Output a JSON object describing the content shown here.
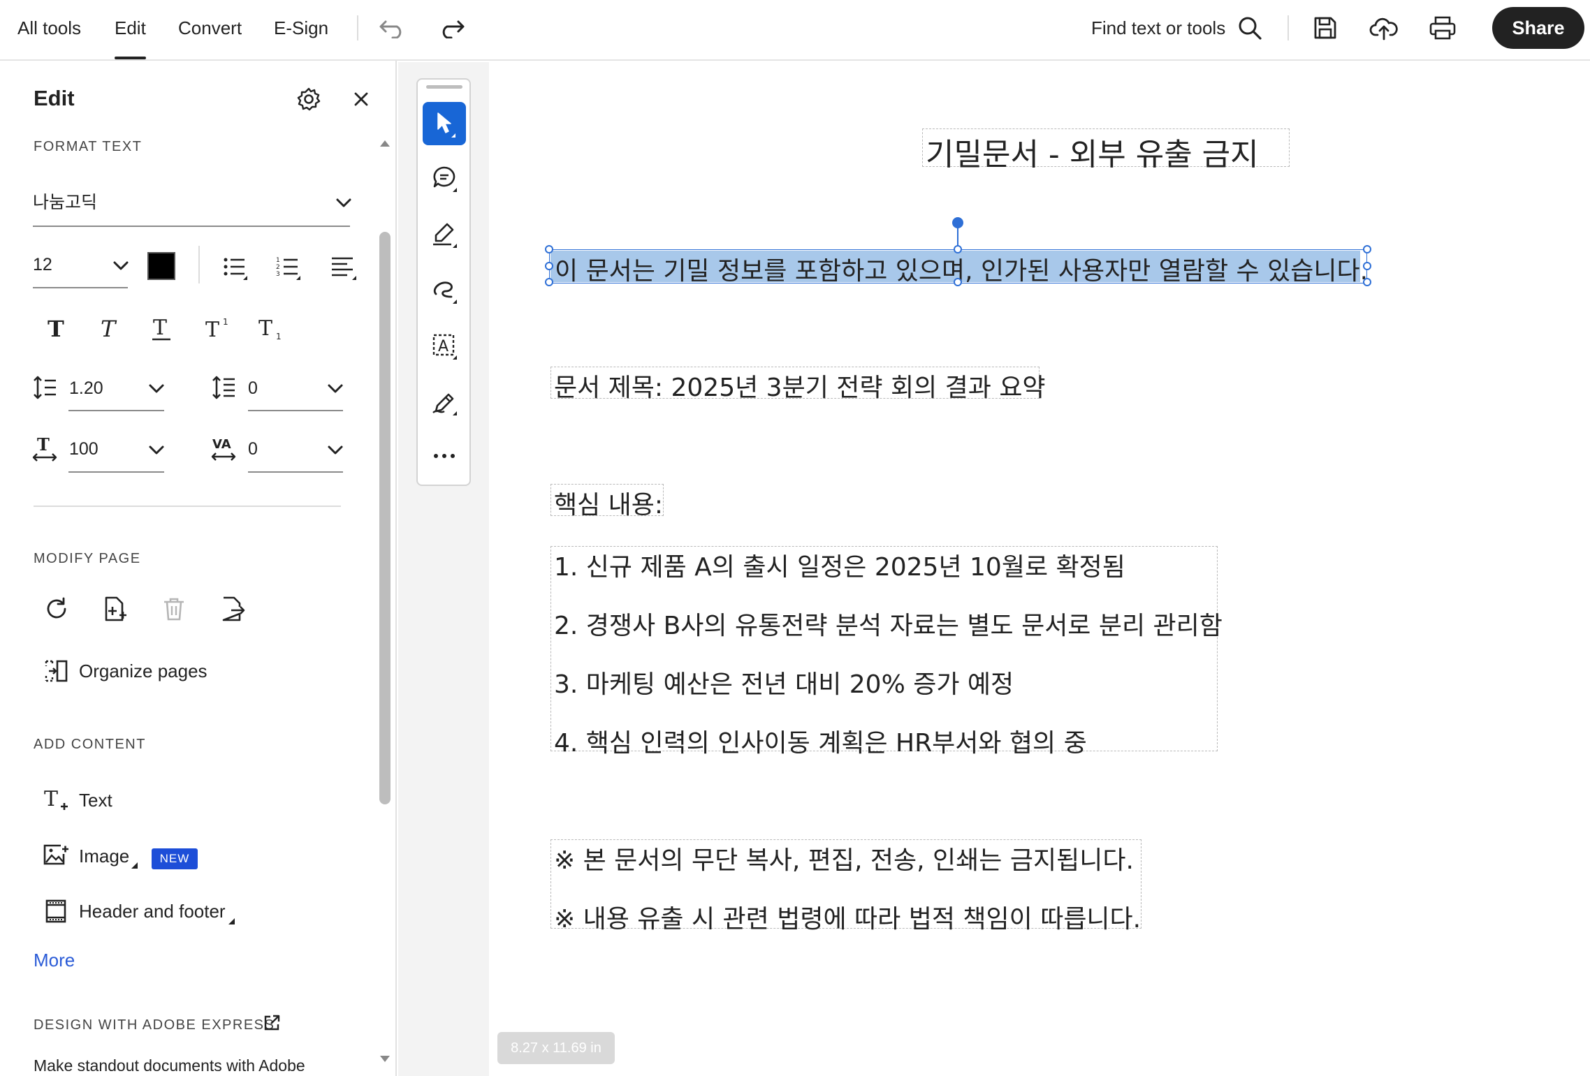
{
  "nav": {
    "tabs": [
      {
        "label": "All tools"
      },
      {
        "label": "Edit"
      },
      {
        "label": "Convert"
      },
      {
        "label": "E-Sign"
      }
    ],
    "find_label": "Find text or tools",
    "share_label": "Share"
  },
  "panel": {
    "title": "Edit",
    "format_text": {
      "section_label": "FORMAT TEXT",
      "font_family": "나눔고딕",
      "font_size": "12",
      "text_color": "#000000",
      "line_spacing": "1.20",
      "paragraph_spacing": "0",
      "horizontal_scale": "100",
      "char_spacing": "0"
    },
    "modify_page": {
      "section_label": "MODIFY PAGE",
      "organize_label": "Organize pages"
    },
    "add_content": {
      "section_label": "ADD CONTENT",
      "text_label": "Text",
      "image_label": "Image",
      "new_badge": "NEW",
      "header_footer_label": "Header and footer",
      "more_label": "More"
    },
    "design": {
      "section_label": "DESIGN WITH ADOBE EXPRESS",
      "subtitle": "Make standout documents with Adobe"
    }
  },
  "document": {
    "title": "기밀문서 - 외부 유출 금지",
    "selected_line": "이 문서는 기밀 정보를 포함하고 있으며, 인가된 사용자만 열람할 수 있습니다.",
    "doc_title_line": "문서 제목: 2025년 3분기 전략 회의 결과 요약",
    "key_label": "핵심 내용:",
    "items": [
      "1. 신규 제품 A의 출시 일정은 2025년 10월로 확정됨",
      "2. 경쟁사 B사의 유통전략 분석 자료는 별도 문서로 분리 관리함",
      "3. 마케팅 예산은 전년 대비 20% 증가 예정",
      "4. 핵심 인력의 인사이동 계획은 HR부서와 협의 중"
    ],
    "notices": [
      "※ 본 문서의 무단 복사, 편집, 전송, 인쇄는 금지됩니다.",
      "※ 내용 유출 시 관련 법령에 따라 법적 책임이 따릅니다."
    ],
    "page_size": "8.27 x 11.69 in"
  }
}
